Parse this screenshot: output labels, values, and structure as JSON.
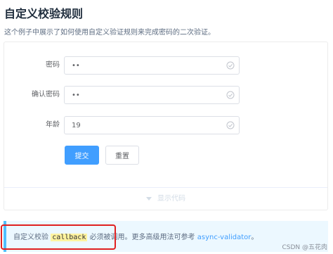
{
  "page": {
    "title": "自定义校验规则",
    "description": "这个例子中展示了如何使用自定义验证规则来完成密码的二次验证。"
  },
  "form": {
    "fields": [
      {
        "label": "密码",
        "value": "••"
      },
      {
        "label": "确认密码",
        "value": "••"
      },
      {
        "label": "年龄",
        "value": "19"
      }
    ],
    "submit_label": "提交",
    "reset_label": "重置"
  },
  "demo_control": {
    "label": "显示代码"
  },
  "tip": {
    "prefix": "自定义校验 ",
    "code": "callback",
    "middle": " 必须被调用。",
    "suffix": "更多高级用法可参考 ",
    "link": "async-validator",
    "end": "。"
  },
  "watermark": "CSDN @五花肉",
  "colors": {
    "primary": "#409eff",
    "tip_background": "#ecf8ff",
    "tip_border": "#50bfff",
    "annotation": "#e02020",
    "highlight": "#fff3a0"
  },
  "icons": {
    "field_status": "check-circle-icon",
    "toggle": "caret-down-icon"
  }
}
